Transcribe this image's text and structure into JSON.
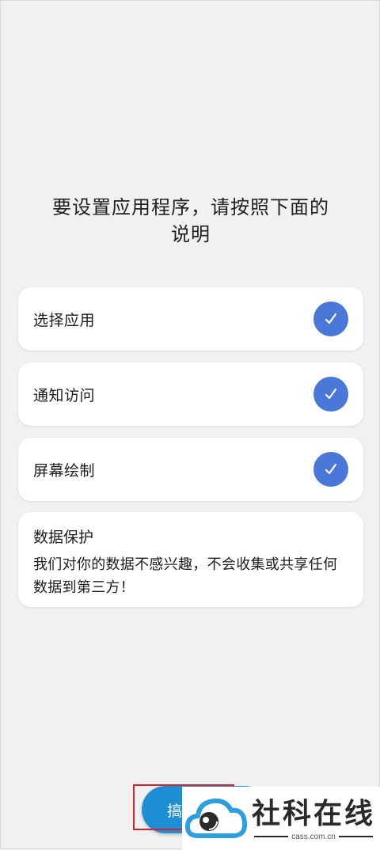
{
  "header": {
    "instruction_line1": "要设置应用程序，请按照下面的",
    "instruction_line2": "说明"
  },
  "steps": [
    {
      "label": "选择应用",
      "status": "done"
    },
    {
      "label": "通知访问",
      "status": "done"
    },
    {
      "label": "屏幕绘制",
      "status": "done"
    }
  ],
  "privacy": {
    "title": "数据保护",
    "line1": "我们对你的数据不感兴趣，不会收集或共享任何",
    "line2": "数据到第三方！"
  },
  "bottom_button": {
    "label": "搞"
  },
  "watermark": {
    "name": "社科在线",
    "domain": "cass.com.cn"
  },
  "colors": {
    "background": "#f1f1f1",
    "check_circle": "#4a78d8",
    "primary_button": "#1e8fd4",
    "highlight": "#d6242b"
  }
}
